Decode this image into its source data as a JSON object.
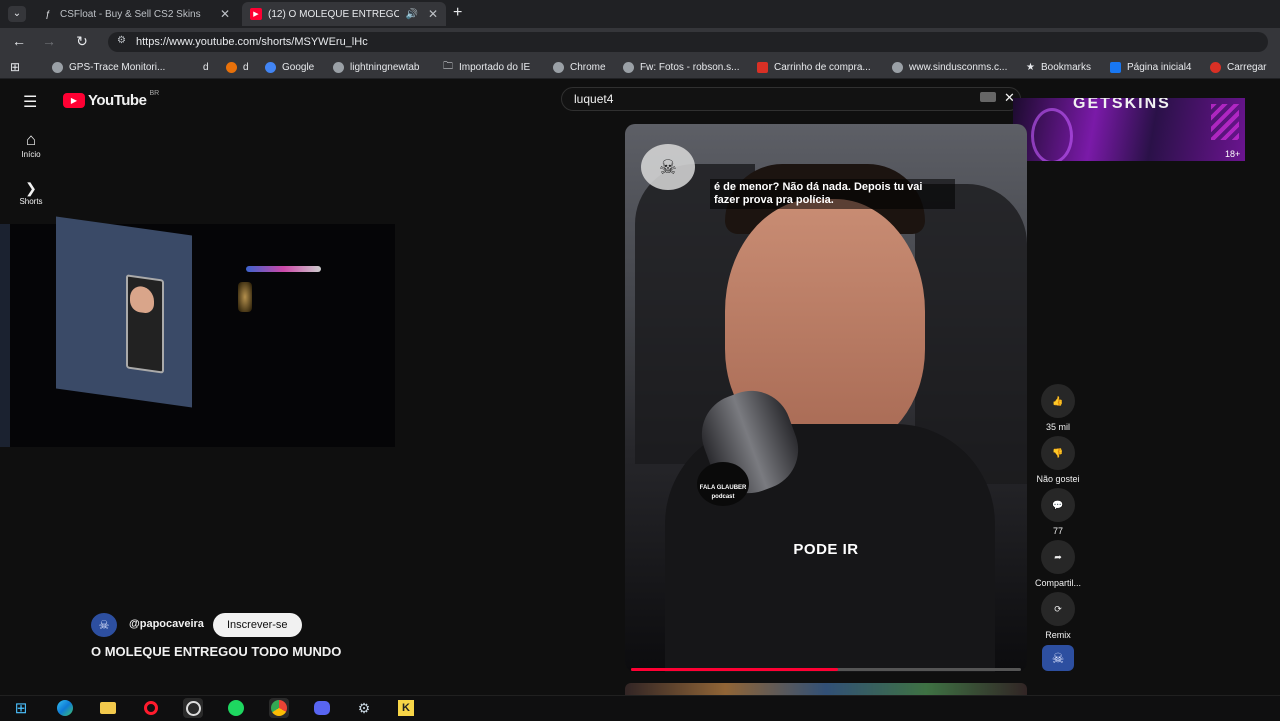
{
  "browser": {
    "tabs": [
      {
        "title": "CSFloat - Buy & Sell CS2 Skins",
        "fav": "ƒ",
        "active": false
      },
      {
        "title": "(12) O MOLEQUE ENTREGO",
        "fav": "▶",
        "active": true
      }
    ],
    "url": "https://www.youtube.com/shorts/MSYWEru_lHc",
    "bookmarks": [
      {
        "label": "GPS-Trace Monitori...",
        "color": "#9aa0a6"
      },
      {
        "label": "d",
        "color": "#202124"
      },
      {
        "label": "d",
        "color": "#e8710a"
      },
      {
        "label": "Google",
        "color": "#4285f4"
      },
      {
        "label": "lightningnewtab",
        "color": "#9aa0a6"
      },
      {
        "label": "Importado do IE",
        "color": "#9aa0a6"
      },
      {
        "label": "Chrome",
        "color": "#9aa0a6"
      },
      {
        "label": "Fw: Fotos - robson.s...",
        "color": "#9aa0a6"
      },
      {
        "label": "Carrinho de compra...",
        "color": "#d93025"
      },
      {
        "label": "www.sindusconms.c...",
        "color": "#9aa0a6"
      },
      {
        "label": "Bookmarks",
        "color": "#e8eaed"
      },
      {
        "label": "Página inicial4",
        "color": "#1877f2"
      },
      {
        "label": "Carregar",
        "color": "#d93025"
      }
    ]
  },
  "youtube": {
    "logo_text": "YouTube",
    "region": "BR",
    "search_value": "luquet4",
    "rail": [
      {
        "label": "Início",
        "icon": "home-icon"
      },
      {
        "label": "Shorts",
        "icon": "shorts-icon"
      }
    ],
    "ad": {
      "text": "GETSKINS",
      "badge": "18+"
    },
    "video": {
      "subtitle": "é de menor? Não dá nada. Depois tu vai fazer prova pra polícia.",
      "caption": "PODE IR",
      "mic_label": "FALA GLAUBER podcast",
      "progress": 0.53
    },
    "actions": [
      {
        "label": "35 mil",
        "icon": "like-icon",
        "glyph": "👍"
      },
      {
        "label": "Não gostei",
        "icon": "dislike-icon",
        "glyph": "👎"
      },
      {
        "label": "77",
        "icon": "comment-icon",
        "glyph": "💬"
      },
      {
        "label": "Compartil...",
        "icon": "share-icon",
        "glyph": "➦"
      },
      {
        "label": "Remix",
        "icon": "remix-icon",
        "glyph": "⟳"
      }
    ],
    "channel": {
      "handle": "@papocaveira",
      "subscribe_label": "Inscrever-se"
    },
    "short_title": "O MOLEQUE ENTREGOU TODO MUNDO"
  },
  "taskbar": [
    "windows-start-icon",
    "edge-icon",
    "file-explorer-icon",
    "opera-icon",
    "obs-icon",
    "spotify-icon",
    "chrome-icon",
    "discord-icon",
    "steam-icon",
    "app-icon"
  ]
}
